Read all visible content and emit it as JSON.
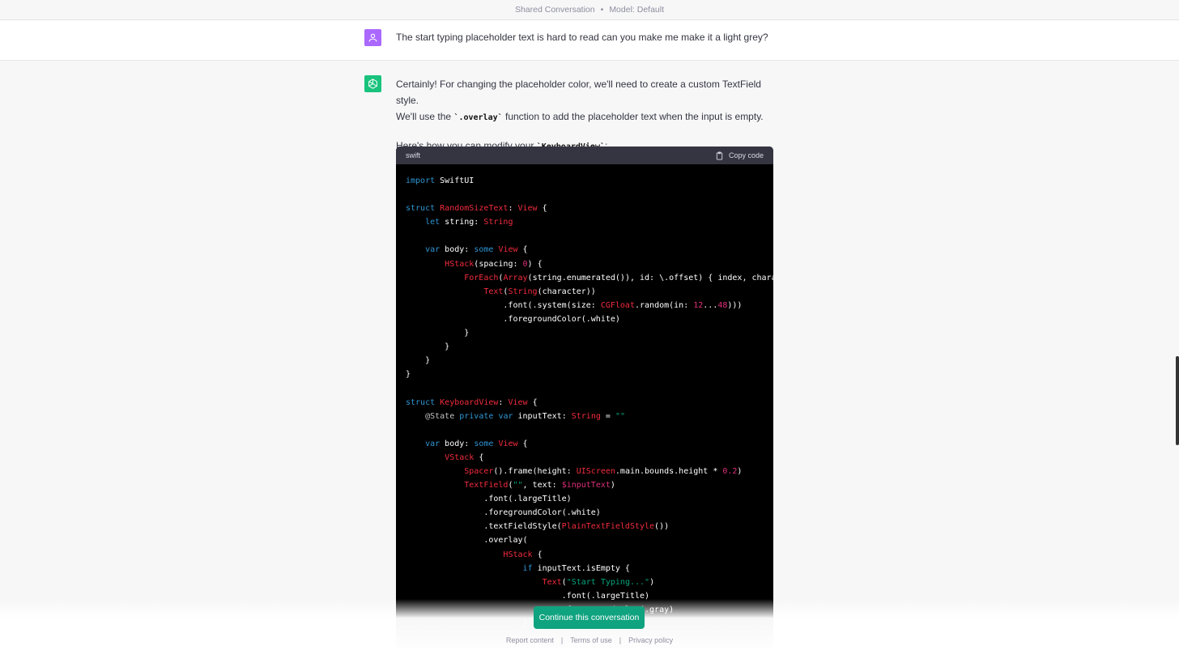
{
  "header": {
    "title": "Shared Conversation",
    "separator": "•",
    "model": "Model: Default"
  },
  "user": {
    "avatar_icon": "user-icon",
    "message": "The start typing placeholder text is hard to read can you make me make it a light grey?"
  },
  "assistant": {
    "avatar_icon": "openai-logo",
    "p1_line1": "Certainly! For changing the placeholder color, we'll need to create a custom TextField style.",
    "p1_line2_pre": "We'll use the ",
    "p1_code": "`.overlay`",
    "p1_line2_post": " function to add the placeholder text when the input is empty.",
    "p2_pre": "Here's how you can modify your ",
    "p2_code": "`KeyboardView`",
    "p2_post": ":"
  },
  "code": {
    "language": "swift",
    "copy_label": "Copy code",
    "copy_icon": "clipboard-icon",
    "lines": [
      [
        [
          "import",
          "kw"
        ],
        [
          " SwiftUI",
          ""
        ]
      ],
      [],
      [
        [
          "struct",
          "kw"
        ],
        [
          " ",
          ""
        ],
        [
          "RandomSizeText",
          "ty"
        ],
        [
          ": ",
          ""
        ],
        [
          "View",
          "ty"
        ],
        [
          " {",
          ""
        ]
      ],
      [
        [
          "    ",
          ""
        ],
        [
          "let",
          "kw"
        ],
        [
          " string: ",
          ""
        ],
        [
          "String",
          "ty"
        ]
      ],
      [],
      [
        [
          "    ",
          ""
        ],
        [
          "var",
          "kw"
        ],
        [
          " body: ",
          ""
        ],
        [
          "some",
          "kw"
        ],
        [
          " ",
          ""
        ],
        [
          "View",
          "ty"
        ],
        [
          " {",
          ""
        ]
      ],
      [
        [
          "        ",
          ""
        ],
        [
          "HStack",
          "ty"
        ],
        [
          "(spacing: ",
          ""
        ],
        [
          "0",
          "nm"
        ],
        [
          ") {",
          ""
        ]
      ],
      [
        [
          "            ",
          ""
        ],
        [
          "ForEach",
          "ty"
        ],
        [
          "(",
          ""
        ],
        [
          "Array",
          "ty"
        ],
        [
          "(string.enumerated()), id: \\.offset) { index, chara",
          ""
        ]
      ],
      [
        [
          "                ",
          ""
        ],
        [
          "Text",
          "ty"
        ],
        [
          "(",
          ""
        ],
        [
          "String",
          "ty"
        ],
        [
          "(character))",
          ""
        ]
      ],
      [
        [
          "                    .font(.system(size: ",
          ""
        ],
        [
          "CGFloat",
          "ty"
        ],
        [
          ".random(in: ",
          ""
        ],
        [
          "12",
          "nm"
        ],
        [
          "...",
          ""
        ],
        [
          "48",
          "nm"
        ],
        [
          ")))",
          ""
        ]
      ],
      [
        [
          "                    .foregroundColor(.white)",
          ""
        ]
      ],
      [
        [
          "            }",
          ""
        ]
      ],
      [
        [
          "        }",
          ""
        ]
      ],
      [
        [
          "    }",
          ""
        ]
      ],
      [
        [
          "}",
          ""
        ]
      ],
      [],
      [
        [
          "struct",
          "kw"
        ],
        [
          " ",
          ""
        ],
        [
          "KeyboardView",
          "ty"
        ],
        [
          ": ",
          ""
        ],
        [
          "View",
          "ty"
        ],
        [
          " {",
          ""
        ]
      ],
      [
        [
          "    ",
          ""
        ],
        [
          "@State",
          "at"
        ],
        [
          " ",
          ""
        ],
        [
          "private",
          "kw"
        ],
        [
          " ",
          ""
        ],
        [
          "var",
          "kw"
        ],
        [
          " inputText: ",
          ""
        ],
        [
          "String",
          "ty"
        ],
        [
          " = ",
          ""
        ],
        [
          "\"\"",
          "st"
        ]
      ],
      [],
      [
        [
          "    ",
          ""
        ],
        [
          "var",
          "kw"
        ],
        [
          " body: ",
          ""
        ],
        [
          "some",
          "kw"
        ],
        [
          " ",
          ""
        ],
        [
          "View",
          "ty"
        ],
        [
          " {",
          ""
        ]
      ],
      [
        [
          "        ",
          ""
        ],
        [
          "VStack",
          "ty"
        ],
        [
          " {",
          ""
        ]
      ],
      [
        [
          "            ",
          ""
        ],
        [
          "Spacer",
          "ty"
        ],
        [
          "().frame(height: ",
          ""
        ],
        [
          "UIScreen",
          "ty"
        ],
        [
          ".main.bounds.height * ",
          ""
        ],
        [
          "0.2",
          "nm"
        ],
        [
          ")",
          ""
        ]
      ],
      [
        [
          "            ",
          ""
        ],
        [
          "TextField",
          "ty"
        ],
        [
          "(",
          ""
        ],
        [
          "\"\"",
          "st"
        ],
        [
          ", text: ",
          ""
        ],
        [
          "$inputText",
          "nm"
        ],
        [
          ")",
          ""
        ]
      ],
      [
        [
          "                .font(.largeTitle)",
          ""
        ]
      ],
      [
        [
          "                .foregroundColor(.white)",
          ""
        ]
      ],
      [
        [
          "                .textFieldStyle(",
          ""
        ],
        [
          "PlainTextFieldStyle",
          "ty"
        ],
        [
          "())",
          ""
        ]
      ],
      [
        [
          "                .overlay(",
          ""
        ]
      ],
      [
        [
          "                    ",
          ""
        ],
        [
          "HStack",
          "ty"
        ],
        [
          " {",
          ""
        ]
      ],
      [
        [
          "                        ",
          ""
        ],
        [
          "if",
          "kw"
        ],
        [
          " inputText.isEmpty {",
          ""
        ]
      ],
      [
        [
          "                            ",
          ""
        ],
        [
          "Text",
          "ty"
        ],
        [
          "(",
          ""
        ],
        [
          "\"Start Typing...\"",
          "st"
        ],
        [
          ")",
          ""
        ]
      ],
      [
        [
          "                                .font(.largeTitle)",
          ""
        ]
      ],
      [
        [
          "                                .foregroundColor(.gray)",
          ""
        ]
      ],
      [
        [
          "                        }",
          ""
        ]
      ]
    ]
  },
  "cta": {
    "continue_label": "Continue this conversation"
  },
  "footer": {
    "report": "Report content",
    "sep": "|",
    "terms": "Terms of use",
    "privacy": "Privacy policy"
  }
}
